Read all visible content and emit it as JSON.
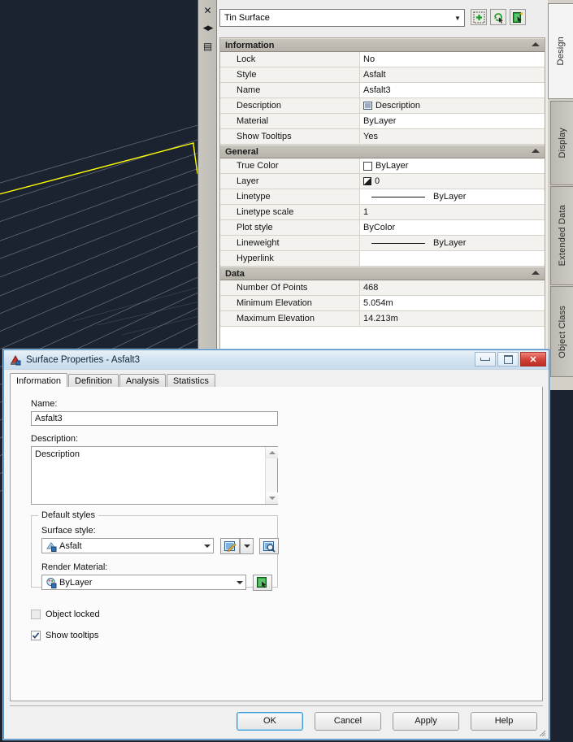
{
  "app": {
    "canvas_bg": "#1b2230",
    "contour_color": "#8d949e",
    "boundary_color": "#ffff00"
  },
  "palette": {
    "gutter": [
      {
        "name": "close-icon",
        "glyph": "✕"
      },
      {
        "name": "auto-hide-icon",
        "glyph": "◀▶"
      },
      {
        "name": "palette-menu-icon",
        "glyph": "▤"
      }
    ],
    "object_combo": {
      "value": "Tin Surface",
      "arrow": "▼"
    },
    "tools": [
      {
        "name": "select-objects-button",
        "title": "Select objects"
      },
      {
        "name": "quick-select-button",
        "title": "Quick Select"
      },
      {
        "name": "pick-object-button",
        "title": "Pick object"
      }
    ],
    "right_tabs": [
      {
        "label": "Design",
        "active": true
      },
      {
        "label": "Display",
        "active": false
      },
      {
        "label": "Extended Data",
        "active": false
      },
      {
        "label": "Object Class",
        "active": false
      }
    ],
    "sections": [
      {
        "title": "Information",
        "rows": [
          {
            "name": "Lock",
            "value": "No",
            "icon": null
          },
          {
            "name": "Style",
            "value": "Asfalt",
            "icon": null
          },
          {
            "name": "Name",
            "value": "Asfalt3",
            "icon": null
          },
          {
            "name": "Description",
            "value": "Description",
            "icon": "description-icon"
          },
          {
            "name": "Material",
            "value": "ByLayer",
            "icon": null
          },
          {
            "name": "Show Tooltips",
            "value": "Yes",
            "icon": null
          }
        ]
      },
      {
        "title": "General",
        "rows": [
          {
            "name": "True Color",
            "value": "ByLayer",
            "icon": "color-swatch-icon"
          },
          {
            "name": "Layer",
            "value": "0",
            "icon": "layer-icon"
          },
          {
            "name": "Linetype",
            "value": "ByLayer",
            "icon": "linetype-line-icon"
          },
          {
            "name": "Linetype scale",
            "value": "1",
            "icon": null
          },
          {
            "name": "Plot style",
            "value": "ByColor",
            "icon": null
          },
          {
            "name": "Lineweight",
            "value": "ByLayer",
            "icon": "lineweight-line-icon"
          },
          {
            "name": "Hyperlink",
            "value": "",
            "icon": null
          }
        ]
      },
      {
        "title": "Data",
        "rows": [
          {
            "name": "Number Of Points",
            "value": "468",
            "icon": null
          },
          {
            "name": "Minimum Elevation",
            "value": "5.054m",
            "icon": null
          },
          {
            "name": "Maximum Elevation",
            "value": "14.213m",
            "icon": null
          }
        ]
      }
    ]
  },
  "dialog": {
    "title": "Surface Properties - Asfalt3",
    "window_buttons": {
      "minimize": "minimize",
      "maximize": "maximize",
      "close": "✕"
    },
    "tabs": [
      {
        "label": "Information",
        "active": true
      },
      {
        "label": "Definition",
        "active": false
      },
      {
        "label": "Analysis",
        "active": false
      },
      {
        "label": "Statistics",
        "active": false
      }
    ],
    "name_label": "Name:",
    "name_value": "Asfalt3",
    "description_label": "Description:",
    "description_value": "Description",
    "default_styles": {
      "legend": "Default styles",
      "surface_style_label": "Surface style:",
      "surface_style_value": "Asfalt",
      "render_material_label": "Render Material:",
      "render_material_value": "ByLayer",
      "buttons": [
        {
          "name": "edit-style-button"
        },
        {
          "name": "edit-style-dropdown"
        },
        {
          "name": "preview-style-button"
        },
        {
          "name": "select-render-material-button"
        }
      ]
    },
    "checkboxes": [
      {
        "label": "Object locked",
        "checked": false,
        "disabled": true
      },
      {
        "label": "Show tooltips",
        "checked": true,
        "disabled": false
      }
    ],
    "buttons": [
      {
        "label": "OK",
        "default": true
      },
      {
        "label": "Cancel",
        "default": false
      },
      {
        "label": "Apply",
        "default": false
      },
      {
        "label": "Help",
        "default": false
      }
    ]
  }
}
